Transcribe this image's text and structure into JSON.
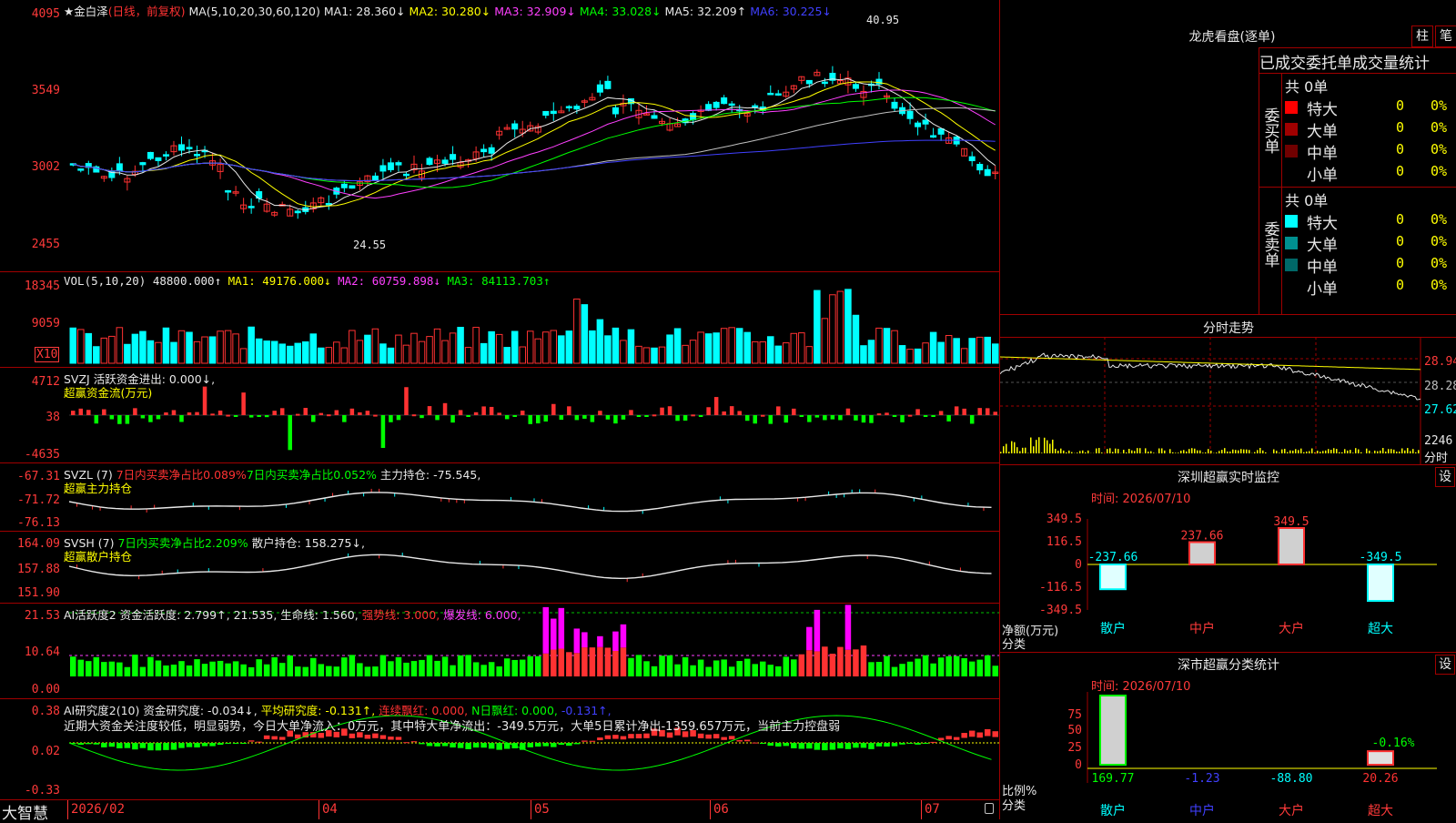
{
  "main": {
    "title": "★金白泽",
    "period": "(日线，前复权)",
    "ma_label": "MA(5,10,20,30,60,120)",
    "ma": [
      "MA1: 28.360↓",
      "MA2: 30.280↓",
      "MA3: 32.909↓",
      "MA4: 33.028↓",
      "MA5: 32.209↑",
      "MA6: 30.225↓"
    ],
    "y_ticks": [
      "4095",
      "3549",
      "3002",
      "2455"
    ],
    "high_mark": "40.95",
    "low_mark": "24.55"
  },
  "vol": {
    "label": "VOL(5,10,20)",
    "value": "48800.000↑",
    "ma1": "MA1: 49176.000↓",
    "ma2": "MA2: 60759.898↓",
    "ma3": "MA3: 84113.703↑",
    "y_ticks": [
      "18345",
      "9059"
    ],
    "unit": "X10"
  },
  "svzj": {
    "label": "SVZJ  活跃资金进出: 0.000↓,",
    "sub": "超赢资金流(万元)",
    "y_ticks": [
      "4712",
      "38",
      "-4635"
    ]
  },
  "svzl": {
    "label": "SVZL (7)",
    "a": "7日内买卖净占比0.089%",
    "b": "7日内买卖净占比0.052%",
    "c": "主力持仓: -75.545,",
    "sub": "超赢主力持仓",
    "y_ticks": [
      "-67.31",
      "-71.72",
      "-76.13"
    ]
  },
  "svsh": {
    "label": "SVSH (7)",
    "a": "7日内买卖净占比2.209%",
    "c": "散户持仓: 158.275↓,",
    "sub": "超赢散户持仓",
    "y_ticks": [
      "164.09",
      "157.88",
      "151.90"
    ]
  },
  "ai1": {
    "label": "AI活跃度2 资金活跃度: 2.799↑,",
    "b": "21.535,",
    "c": "生命线: 1.560,",
    "d": "强势线: 3.000,",
    "e": "爆发线: 6.000,",
    "y_ticks": [
      "21.53",
      "10.64",
      "0.00"
    ]
  },
  "ai2": {
    "label": "AI研究度2(10) 资金研究度: -0.034↓,",
    "b": "平均研究度: -0.131↑,",
    "c": "连续飘红: 0.000,",
    "d": "N日飘红: 0.000,",
    "e": "-0.131↑,",
    "text": "近期大资金关注度较低，明显弱势，今日大单净流入：0万元，其中特大单净流出：-349.5万元，大单5日累计净出-1359.657万元，当前主力控盘弱",
    "y_ticks": [
      "0.38",
      "0.02",
      "-0.33"
    ]
  },
  "bottom": {
    "brand": "大智慧",
    "dates": [
      "2026/02",
      "04",
      "05",
      "06",
      "07"
    ]
  },
  "dragon": {
    "title": "龙虎看盘(逐单)",
    "btn1": "柱",
    "btn2": "笔",
    "header": "已成交委托单成交量统计",
    "buy_label": "委买单",
    "sell_label": "委卖单",
    "buy_total": "共 0单",
    "sell_total": "共 0单",
    "rows": [
      {
        "name": "特大",
        "qty": "0",
        "pct": "0%",
        "color": "#ff0000"
      },
      {
        "name": "大单",
        "qty": "0",
        "pct": "0%",
        "color": "#a00000"
      },
      {
        "name": "中单",
        "qty": "0",
        "pct": "0%",
        "color": "#700000"
      },
      {
        "name": "小单",
        "qty": "0",
        "pct": "0%",
        "color": "#000000"
      }
    ],
    "srows": [
      {
        "name": "特大",
        "qty": "0",
        "pct": "0%",
        "color": "#00ffff"
      },
      {
        "name": "大单",
        "qty": "0",
        "pct": "0%",
        "color": "#009090"
      },
      {
        "name": "中单",
        "qty": "0",
        "pct": "0%",
        "color": "#006868"
      },
      {
        "name": "小单",
        "qty": "0",
        "pct": "0%",
        "color": "#000000"
      }
    ]
  },
  "intraday": {
    "title": "分时走势",
    "y_ticks": [
      "28.94",
      "28.28",
      "27.62"
    ],
    "vol_tick": "2246",
    "vol_label": "分时"
  },
  "monitor": {
    "title": "深圳超赢实时监控",
    "btn": "设",
    "time": "时间: 2026/07/10",
    "y_ticks": [
      "349.5",
      "116.5",
      "0",
      "-116.5",
      "-349.5"
    ],
    "ylabel": "净额(万元)",
    "xlabel": "分类",
    "cats": [
      "散户",
      "中户",
      "大户",
      "超大"
    ],
    "values": [
      -237.66,
      237.66,
      349.5,
      -349.5
    ],
    "value_labels": [
      "-237.66",
      "237.66",
      "349.5",
      "-349.5"
    ]
  },
  "stats": {
    "title": "深市超赢分类统计",
    "btn": "设",
    "time": "时间: 2026/07/10",
    "y_ticks": [
      "75",
      "50",
      "25",
      "0"
    ],
    "ylabel": "比例%",
    "xlabel": "分类",
    "cats": [
      "散户",
      "中户",
      "大户",
      "超大"
    ],
    "values": [
      169.77,
      -1.23,
      -88.8,
      20.26
    ],
    "value_labels": [
      "169.77",
      "-1.23",
      "-88.80",
      "20.26"
    ],
    "extra": "-0.16%"
  }
}
